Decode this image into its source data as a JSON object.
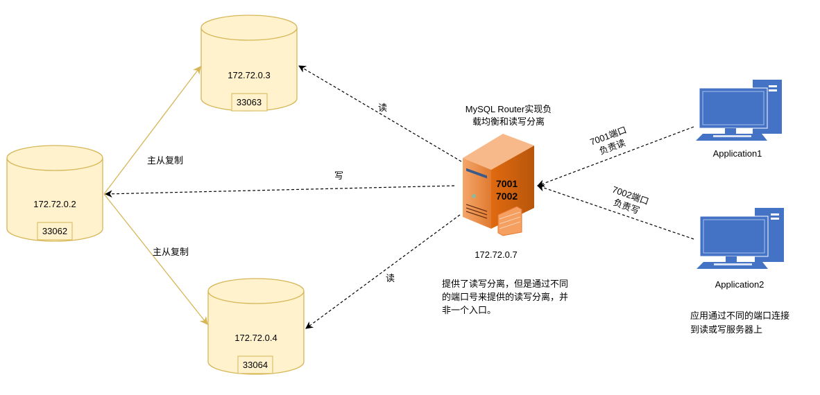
{
  "databases": [
    {
      "ip": "172.72.0.3",
      "port": "33063"
    },
    {
      "ip": "172.72.0.2",
      "port": "33062"
    },
    {
      "ip": "172.72.0.4",
      "port": "33064"
    }
  ],
  "router": {
    "title_lines": [
      "MySQL Router实现负",
      "载均衡和读写分离"
    ],
    "ports": [
      "7001",
      "7002"
    ],
    "ip": "172.72.0.7",
    "note_lines": [
      "提供了读写分离，但是通过不同",
      "的端口号来提供的读写分离，并",
      "非一个入口。"
    ]
  },
  "edges": {
    "read_top": "读",
    "write": "写",
    "read_bottom": "读",
    "replication_top": "主从复制",
    "replication_bottom": "主从复制",
    "app1_lines": [
      "7001端口",
      "负责读"
    ],
    "app2_lines": [
      "7002端口",
      "负责写"
    ]
  },
  "applications": [
    {
      "name": "Application1"
    },
    {
      "name": "Application2"
    }
  ],
  "app_note_lines": [
    "应用通过不同的端口连接",
    "到读或写服务器上"
  ],
  "colors": {
    "db_fill": "#fff2cc",
    "db_stroke": "#d6b656",
    "pc_blue": "#4472c4",
    "server_orange": "#e8762b"
  }
}
